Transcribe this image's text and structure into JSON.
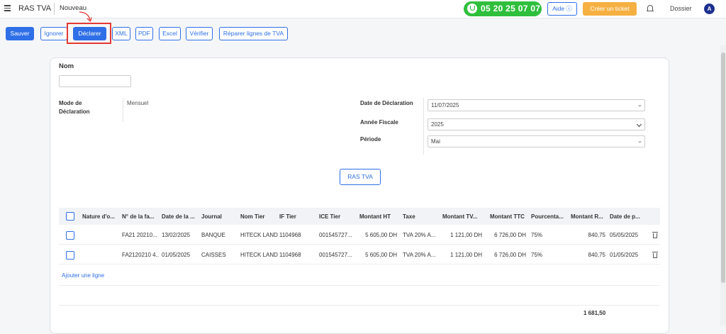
{
  "header": {
    "app_title": "RAS TVA",
    "breadcrumb": "Nouveau",
    "phone": "05 20 25 07 07",
    "help_label": "Aide ⓘ",
    "ticket_label": "Créer un ticket",
    "dossier_label": "Dossier",
    "avatar_initial": "A"
  },
  "toolbar": {
    "save": "Sauver",
    "ignore": "Ignorer",
    "declare": "Déclarer",
    "xml": "XML",
    "pdf": "PDF",
    "excel": "Excel",
    "verify": "Vérifier",
    "repair": "Réparer lignes de TVA"
  },
  "form": {
    "name_label": "Nom",
    "name_value": "",
    "mode_label_line1": "Mode de",
    "mode_label_line2": "Déclaration",
    "mode_value": "Mensuel",
    "date_label": "Date de Déclaration",
    "date_value": "11/07/2025",
    "year_label": "Année Fiscale",
    "year_value": "2025",
    "period_label": "Période",
    "period_value": "Mai",
    "ras_button": "RAS TVA"
  },
  "table": {
    "columns": [
      "Nature d'o...",
      "N° de la fa...",
      "Date de la ...",
      "Journal",
      "Nom Tier",
      "IF Tier",
      "ICE Tier",
      "Montant HT",
      "Taxe",
      "Montant TV...",
      "Montant TTC",
      "Pourcenta...",
      "Montant R...",
      "Date de p..."
    ],
    "rows": [
      {
        "nature": "",
        "invoice_no": "FA21 20210...",
        "invoice_date": "13/02/2025",
        "journal": "BANQUE",
        "tier_name": "HITECK LAND",
        "if_tier": "1104968",
        "ice_tier": "001545727...",
        "amount_ht": "5 605,00 DH",
        "tax": "TVA 20% A...",
        "amount_tva": "1 121,00 DH",
        "amount_ttc": "6 726,00 DH",
        "percent": "75%",
        "amount_r": "840,75",
        "pay_date": "05/05/2025"
      },
      {
        "nature": "",
        "invoice_no": "FA2120210 4...",
        "invoice_date": "01/05/2025",
        "journal": "CAISSES",
        "tier_name": "HITECK LAND",
        "if_tier": "1104968",
        "ice_tier": "001545727...",
        "amount_ht": "5 605,00 DH",
        "tax": "TVA 20% A...",
        "amount_tva": "1 121,00 DH",
        "amount_ttc": "6 726,00 DH",
        "percent": "75%",
        "amount_r": "840,75",
        "pay_date": "01/05/2025"
      }
    ],
    "add_line_label": "Ajouter une ligne",
    "total": "1 681,50"
  }
}
